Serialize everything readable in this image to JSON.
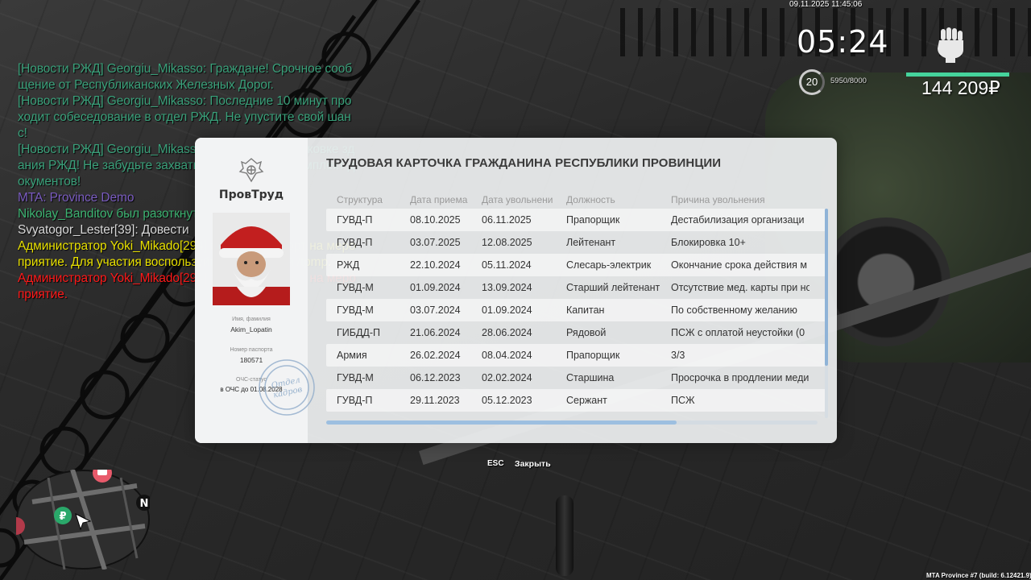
{
  "hud": {
    "datetime": "09.11.2025 11:45:06",
    "time": "05:24",
    "level": "20",
    "exp": "5950/8000",
    "health_fraction": 1.0,
    "money": "144 209₽"
  },
  "chat": [
    {
      "text": "[Новости РЖД] Georgiu_Mikasso: Граждане! Срочное сообщение от Республиканских Железных Дорог.",
      "color": "#3aa07a"
    },
    {
      "text": "[Новости РЖД] Georgiu_Mikasso: Последние 10 минут проходит собеседование в отдел РЖД. Не упустите свой шанс!",
      "color": "#3aa07a"
    },
    {
      "text": "[Новости РЖД] Georgiu_Mikasso: Ждём вас на парковке здания РЖД! Не забудьте захватить с собой весь комплект документов!",
      "color": "#3aa07a"
    },
    {
      "text": "MTA: Province Demo",
      "color": "#7a5cc0"
    },
    {
      "text": "Nikolay_Banditov был разоткнут",
      "color": "#3cb371"
    },
    {
      "text": "Svyatogor_Lester[39]: Довести",
      "color": "#d9d9d9"
    },
    {
      "text": "Администратор Yoki_Mikado[294] открыл телепорт на мероприятие. Для участия воспользуйтесь командой /tpmp.",
      "color": "#e8e000"
    },
    {
      "text": "Администратор Yoki_Mikado[294] закрыл телепорт на мероприятие.",
      "color": "#ff1a1a"
    }
  ],
  "card": {
    "org_name": "ПровТруд",
    "title": "ТРУДОВАЯ КАРТОЧКА ГРАЖДАНИНА РЕСПУБЛИКИ ПРОВИНЦИИ",
    "name_label": "Имя, фамилия",
    "name": "Akim_Lopatin",
    "passport_label": "Номер паспорта",
    "passport": "180571",
    "ochs_label": "ОЧС-статус",
    "ochs": "в ОЧС до 01.08.2028",
    "stamp_text": "Отдел кадров",
    "columns": [
      "Структура",
      "Дата приема",
      "Дата увольнени",
      "Должность",
      "Причина увольнения"
    ],
    "rows": [
      [
        "ГУВД-П",
        "08.10.2025",
        "06.11.2025",
        "Прапорщик",
        "Дестабилизация организаци"
      ],
      [
        "ГУВД-П",
        "03.07.2025",
        "12.08.2025",
        "Лейтенант",
        "Блокировка 10+"
      ],
      [
        "РЖД",
        "22.10.2024",
        "05.11.2024",
        "Слесарь-электрик",
        "Окончание срока действия м"
      ],
      [
        "ГУВД-М",
        "01.09.2024",
        "13.09.2024",
        "Старший лейтенант",
        "Отсутствие мед. карты при но"
      ],
      [
        "ГУВД-М",
        "03.07.2024",
        "01.09.2024",
        "Капитан",
        "По собственному желанию"
      ],
      [
        "ГИБДД-П",
        "21.06.2024",
        "28.06.2024",
        "Рядовой",
        "ПСЖ с оплатой неустойки (0"
      ],
      [
        "Армия",
        "26.02.2024",
        "08.04.2024",
        "Прапорщик",
        "3/3"
      ],
      [
        "ГУВД-М",
        "06.12.2023",
        "02.02.2024",
        "Старшина",
        "Просрочка в продлении меди"
      ],
      [
        "ГУВД-П",
        "29.11.2023",
        "05.12.2023",
        "Сержант",
        "ПСЖ"
      ]
    ]
  },
  "footer": {
    "esc_key": "ESC",
    "close_label": "Закрыть"
  },
  "minimap": {
    "north": "N"
  },
  "build": "MTA Province #7 (build: 6.12421.9)"
}
